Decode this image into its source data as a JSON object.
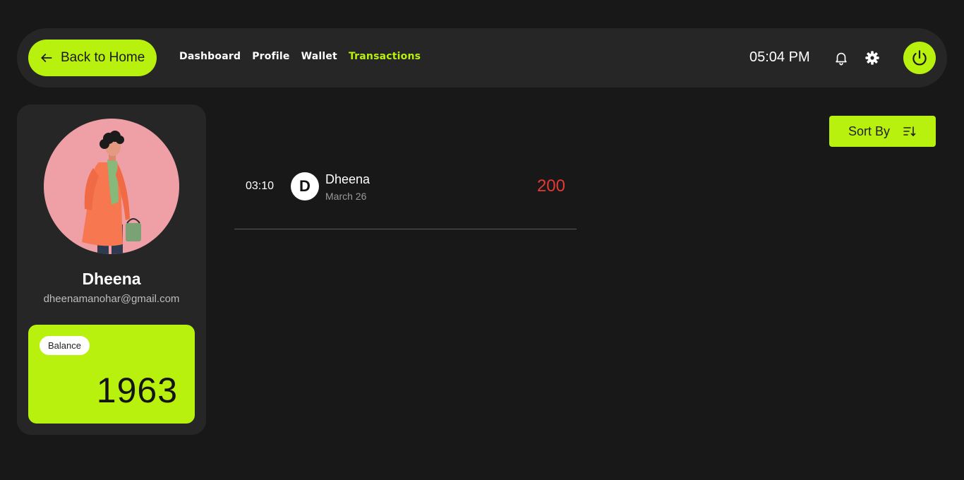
{
  "header": {
    "back_label": "Back to Home",
    "nav": [
      "Dashboard",
      "Profile",
      "Wallet",
      "Transactions"
    ],
    "active_nav": "Transactions",
    "time": "05:04 PM"
  },
  "profile": {
    "name": "Dheena",
    "email": "dheenamanohar@gmail.com",
    "balance_label": "Balance",
    "balance": "1963"
  },
  "transactions": {
    "sort_label": "Sort By",
    "items": [
      {
        "time": "03:10",
        "initial": "D",
        "name": "Dheena",
        "date": "March 26",
        "amount": "200"
      }
    ]
  },
  "colors": {
    "accent": "#b9f10f",
    "background": "#181818",
    "card": "#262626",
    "debit": "#e53935"
  }
}
